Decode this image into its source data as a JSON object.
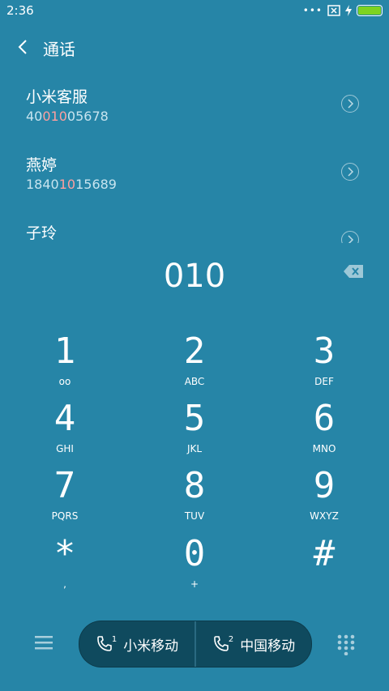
{
  "status": {
    "time": "2:36"
  },
  "header": {
    "title": "通话"
  },
  "contacts": [
    {
      "name": "小米客服",
      "number_pre": "40",
      "number_hl": "010",
      "number_post": "05678"
    },
    {
      "name": "燕婷",
      "number_pre": "1840",
      "number_hl": "10",
      "number_post": "15689"
    },
    {
      "name": "子玲",
      "number_pre": "",
      "number_hl": "",
      "number_post": ""
    }
  ],
  "dialed": "010",
  "keypad": [
    {
      "digit": "1",
      "letters": "ᴏᴏ"
    },
    {
      "digit": "2",
      "letters": "ABC"
    },
    {
      "digit": "3",
      "letters": "DEF"
    },
    {
      "digit": "4",
      "letters": "GHI"
    },
    {
      "digit": "5",
      "letters": "JKL"
    },
    {
      "digit": "6",
      "letters": "MNO"
    },
    {
      "digit": "7",
      "letters": "PQRS"
    },
    {
      "digit": "8",
      "letters": "TUV"
    },
    {
      "digit": "9",
      "letters": "WXYZ"
    },
    {
      "digit": "*",
      "letters": ","
    },
    {
      "digit": "0",
      "letters": "+"
    },
    {
      "digit": "#",
      "letters": ""
    }
  ],
  "calls": {
    "sim1_index": "1",
    "sim1_label": "小米移动",
    "sim2_index": "2",
    "sim2_label": "中国移动"
  },
  "colors": {
    "background": "#2685a7",
    "call_bar": "#0f4a5e",
    "highlight": "#ff9f9f",
    "battery": "#7ed321"
  },
  "icons": [
    "back-arrow-icon",
    "detail-chevron-icon",
    "backspace-icon",
    "menu-icon",
    "dialpad-grid-icon",
    "phone-icon",
    "sim-close-icon",
    "charging-icon",
    "battery-icon"
  ]
}
